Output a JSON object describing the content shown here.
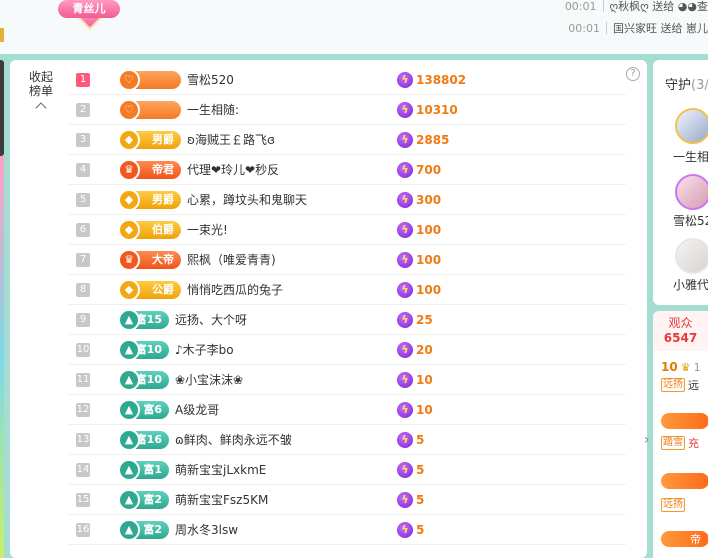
{
  "topbar": {
    "fan_badge": "青丝儿",
    "messages": [
      {
        "time": "00:01",
        "text": "ღ秋枫ღ 送给 ◕◕查"
      },
      {
        "time": "00:01",
        "text": "国兴家旺 送给 崽儿"
      }
    ]
  },
  "rank_panel": {
    "collapse_label_line1": "收起",
    "collapse_label_line2": "榜单",
    "help": "?",
    "rows": [
      {
        "rank": "1",
        "badge": "",
        "badge_type": "guard",
        "name": "雪松520",
        "value": "138802"
      },
      {
        "rank": "2",
        "badge": "",
        "badge_type": "guard",
        "name": "一生相随:",
        "value": "10310"
      },
      {
        "rank": "3",
        "badge": "男爵",
        "badge_type": "gold",
        "name": "ʚ海贼王￡路飞ɞ",
        "value": "2885"
      },
      {
        "rank": "4",
        "badge": "帝君",
        "badge_type": "emperor",
        "name": "代理❤玲儿❤秒反",
        "value": "700"
      },
      {
        "rank": "5",
        "badge": "男爵",
        "badge_type": "gold",
        "name": "心累，蹲坟头和鬼聊天",
        "value": "300"
      },
      {
        "rank": "6",
        "badge": "伯爵",
        "badge_type": "gold",
        "name": "一束光!",
        "value": "100"
      },
      {
        "rank": "7",
        "badge": "大帝",
        "badge_type": "emperor",
        "name": "熙枫（唯爱青青)",
        "value": "100"
      },
      {
        "rank": "8",
        "badge": "公爵",
        "badge_type": "gold",
        "name": "悄悄吃西瓜的兔子",
        "value": "100"
      },
      {
        "rank": "9",
        "badge": "富15",
        "badge_type": "rich",
        "name": "远扬、大个呀",
        "value": "25"
      },
      {
        "rank": "10",
        "badge": "富10",
        "badge_type": "rich",
        "name": "♪木子李bo",
        "value": "20"
      },
      {
        "rank": "11",
        "badge": "富10",
        "badge_type": "rich",
        "name": "❀小宝沫沫❀",
        "value": "10"
      },
      {
        "rank": "12",
        "badge": "富6",
        "badge_type": "rich",
        "name": "A级龙哥",
        "value": "10"
      },
      {
        "rank": "13",
        "badge": "富16",
        "badge_type": "rich",
        "name": "ɷ鲜肉、鲜肉永远不皱",
        "value": "5"
      },
      {
        "rank": "14",
        "badge": "富1",
        "badge_type": "rich",
        "name": "萌新宝宝jLxkmE",
        "value": "5"
      },
      {
        "rank": "15",
        "badge": "富2",
        "badge_type": "rich",
        "name": "萌新宝宝Fsz5KM",
        "value": "5"
      },
      {
        "rank": "16",
        "badge": "富2",
        "badge_type": "rich",
        "name": "周水冬3lsw",
        "value": "5"
      }
    ]
  },
  "guard_panel": {
    "title": "守护",
    "count": "(3/",
    "guards": [
      "一生相",
      "雪松52",
      "小雅代"
    ]
  },
  "audience_panel": {
    "title": "观众",
    "count": "6547",
    "rows": [
      {
        "level": "10",
        "extra": "1",
        "tag": "远扬",
        "name": "远"
      },
      {
        "level": "",
        "extra": "",
        "tag": "",
        "name": ""
      },
      {
        "level": "",
        "extra": "",
        "tag": "踏雪",
        "name": "充"
      },
      {
        "level": "",
        "extra": "",
        "tag": "",
        "name": ""
      },
      {
        "level": "",
        "extra": "",
        "tag": "远扬",
        "name": ""
      },
      {
        "level": "",
        "extra": "",
        "tag": "",
        "name": "帝"
      }
    ]
  }
}
